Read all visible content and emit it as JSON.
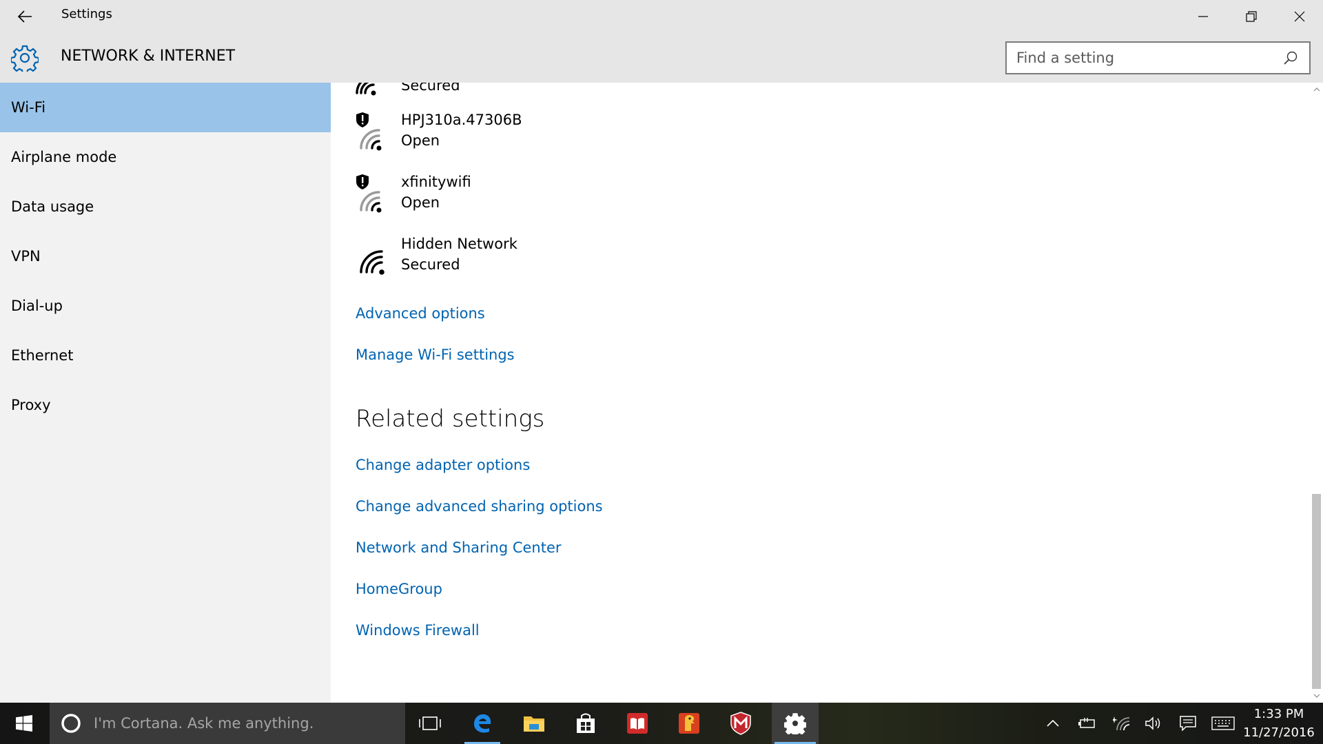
{
  "window": {
    "title": "Settings",
    "section_title": "NETWORK & INTERNET"
  },
  "search": {
    "placeholder": "Find a setting",
    "value": ""
  },
  "sidebar": {
    "items": [
      {
        "label": "Wi-Fi",
        "active": true
      },
      {
        "label": "Airplane mode",
        "active": false
      },
      {
        "label": "Data usage",
        "active": false
      },
      {
        "label": "VPN",
        "active": false
      },
      {
        "label": "Dial-up",
        "active": false
      },
      {
        "label": "Ethernet",
        "active": false
      },
      {
        "label": "Proxy",
        "active": false
      }
    ]
  },
  "networks": [
    {
      "name": "",
      "status": "Secured",
      "icon": "wifi-icon"
    },
    {
      "name": "HPJ310a.47306B",
      "status": "Open",
      "icon": "wifi-open-warning-icon"
    },
    {
      "name": "xfinitywifi",
      "status": "Open",
      "icon": "wifi-open-warning-icon"
    },
    {
      "name": "Hidden Network",
      "status": "Secured",
      "icon": "wifi-icon"
    }
  ],
  "links": {
    "advanced_options": "Advanced options",
    "manage_wifi": "Manage Wi-Fi settings"
  },
  "related": {
    "heading": "Related settings",
    "links": [
      "Change adapter options",
      "Change advanced sharing options",
      "Network and Sharing Center",
      "HomeGroup",
      "Windows Firewall"
    ]
  },
  "taskbar": {
    "cortana_placeholder": "I'm Cortana. Ask me anything.",
    "apps": [
      "task-view-icon",
      "edge-icon",
      "file-explorer-icon",
      "store-icon",
      "reader-icon",
      "app-icon",
      "mcafee-icon",
      "settings-icon"
    ],
    "clock_time": "1:33 PM",
    "clock_date": "11/27/2016"
  },
  "colors": {
    "accent": "#0063b1",
    "selection": "#99c3e8",
    "header_bg": "#e6e6e6",
    "sidebar_bg": "#f2f2f2"
  }
}
